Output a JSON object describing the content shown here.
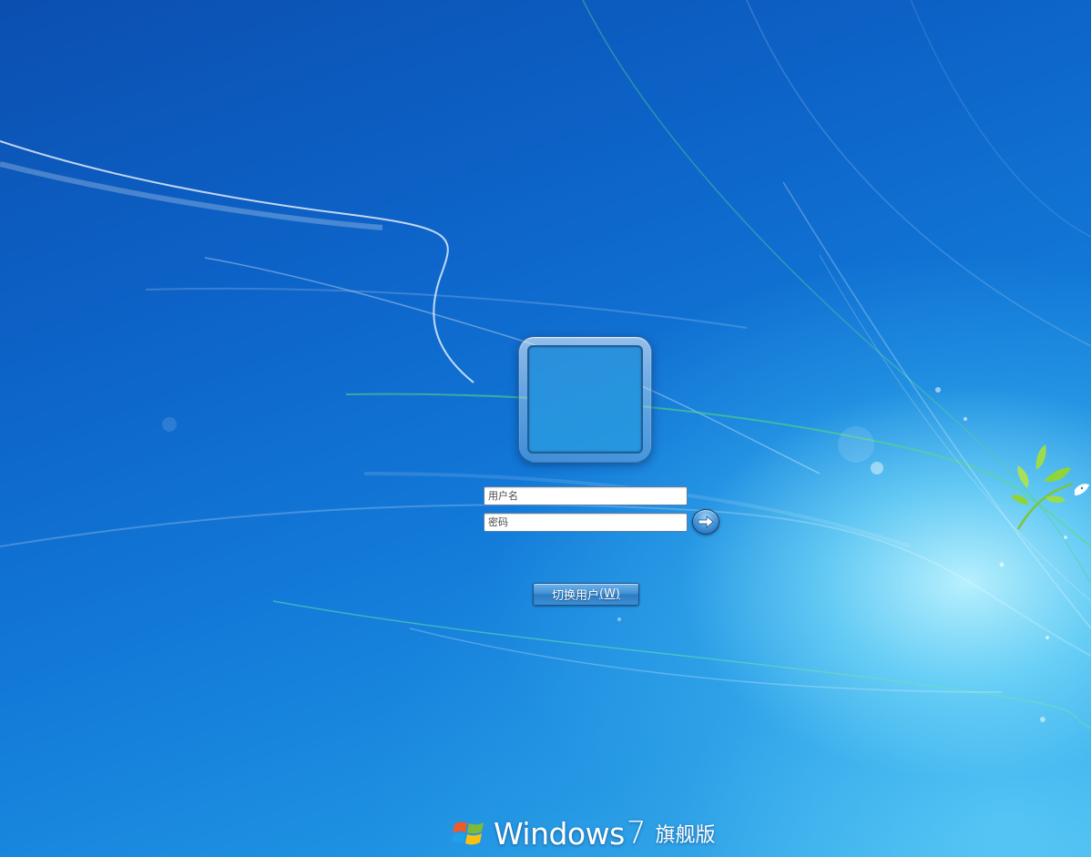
{
  "login": {
    "username_placeholder": "用户名",
    "password_placeholder": "密码",
    "switch_user_label": "切换用户",
    "switch_user_accel": "(W)"
  },
  "brand": {
    "name": "Windows",
    "version": "7",
    "edition": "旗舰版"
  },
  "icons": {
    "submit": "arrow-right-icon",
    "logo": "windows-flag-icon",
    "decor": "bird-branch-icon"
  },
  "colors": {
    "background_top": "#0b4fb0",
    "background_glow": "#bef5ff",
    "button_blue": "#3f8fd4",
    "leaf_green": "#8ed43a"
  }
}
